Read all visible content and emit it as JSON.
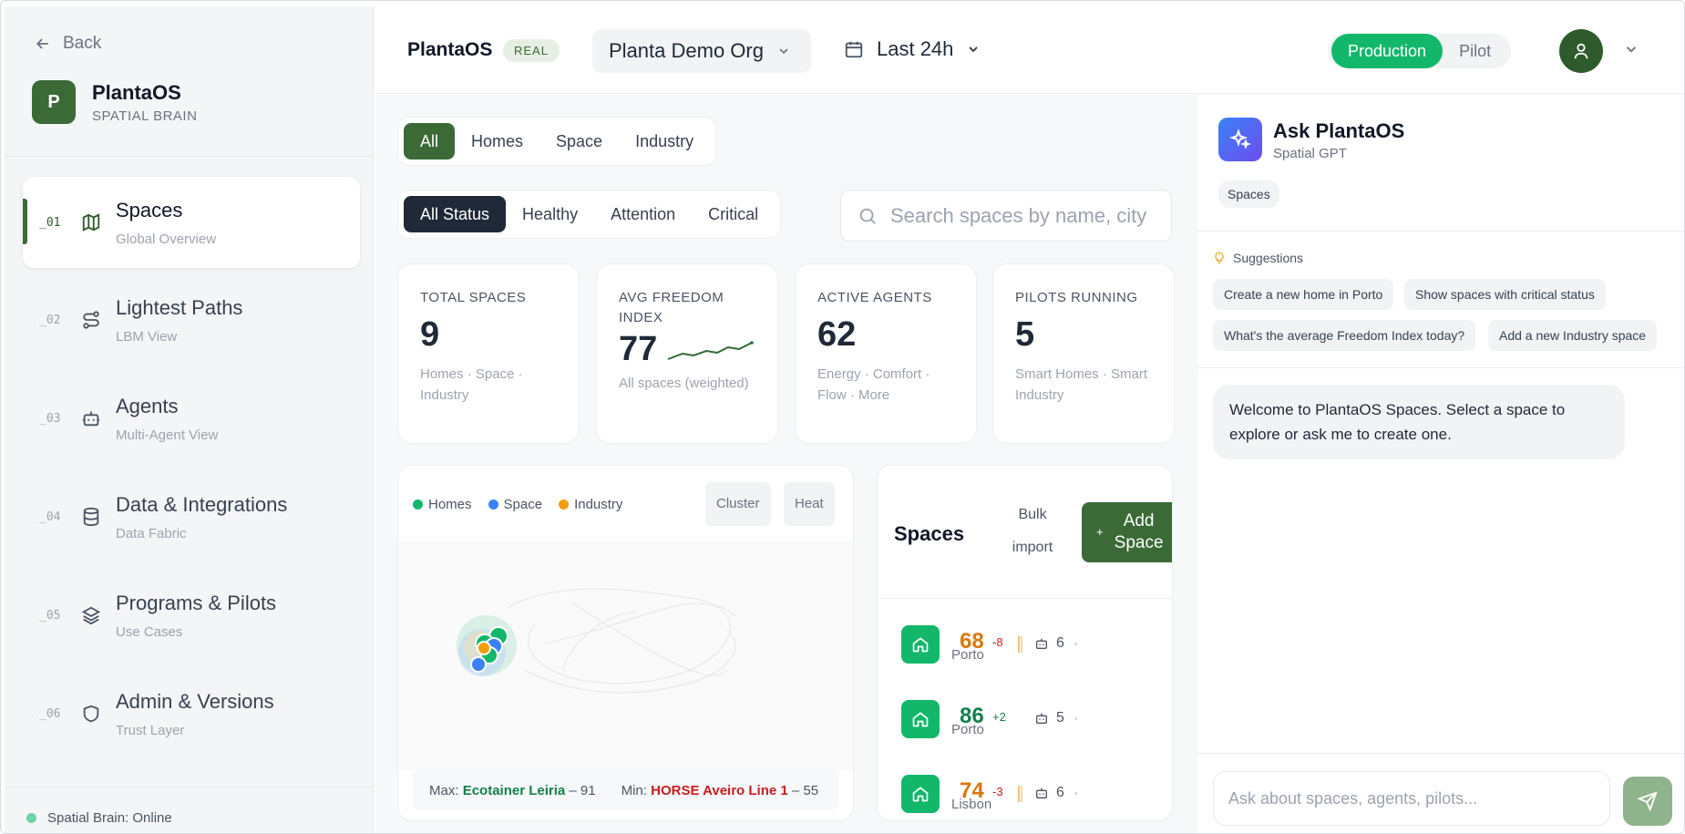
{
  "sidebar": {
    "back_label": "Back",
    "brand": {
      "logo_letter": "P",
      "name": "PlantaOS",
      "subtitle": "SPATIAL BRAIN"
    },
    "items": [
      {
        "num": "_01",
        "title": "Spaces",
        "sub": "Global Overview",
        "icon": "map-icon"
      },
      {
        "num": "_02",
        "title": "Lightest Paths",
        "sub": "LBM View",
        "icon": "route-icon"
      },
      {
        "num": "_03",
        "title": "Agents",
        "sub": "Multi-Agent View",
        "icon": "bot-icon"
      },
      {
        "num": "_04",
        "title": "Data & Integrations",
        "sub": "Data Fabric",
        "icon": "database-icon"
      },
      {
        "num": "_05",
        "title": "Programs & Pilots",
        "sub": "Use Cases",
        "icon": "layers-icon"
      },
      {
        "num": "_06",
        "title": "Admin & Versions",
        "sub": "Trust Layer",
        "icon": "shield-icon"
      }
    ],
    "status": "Spatial Brain: Online"
  },
  "topbar": {
    "app_name": "PlantaOS",
    "badge": "REAL",
    "org": "Planta Demo Org",
    "range": "Last 24h",
    "env": {
      "production": "Production",
      "pilot": "Pilot"
    }
  },
  "filters": {
    "types": [
      "All",
      "Homes",
      "Space",
      "Industry"
    ],
    "statuses": [
      "All Status",
      "Healthy",
      "Attention",
      "Critical"
    ],
    "search_placeholder": "Search spaces by name, city"
  },
  "kpis": [
    {
      "label": "TOTAL SPACES",
      "value": "9",
      "sub": "Homes · Space · Industry"
    },
    {
      "label": "AVG FREEDOM INDEX",
      "value": "77",
      "sub": "All spaces (weighted)"
    },
    {
      "label": "ACTIVE AGENTS",
      "value": "62",
      "sub": "Energy · Comfort · Flow · More"
    },
    {
      "label": "PILOTS RUNNING",
      "value": "5",
      "sub": "Smart Homes · Smart Industry"
    }
  ],
  "map": {
    "legend": [
      "Homes",
      "Space",
      "Industry"
    ],
    "buttons": {
      "cluster": "Cluster",
      "heat": "Heat"
    },
    "max_label": "Max:",
    "max_name": "Ecotainer Leiria",
    "max_value": "– 91",
    "min_label": "Min:",
    "min_name": "HORSE Aveiro Line 1",
    "min_value": "– 55"
  },
  "spaces": {
    "title": "Spaces",
    "bulk_import": "Bulk import",
    "add_label": "Add Space",
    "add_icon": "+",
    "rows": [
      {
        "score": "68",
        "delta": "-8",
        "city": "Porto",
        "agents": "6",
        "score_color": "#d97706",
        "delta_color": "#c81e1e"
      },
      {
        "score": "86",
        "delta": "+2",
        "city": "Porto",
        "agents": "5",
        "score_color": "#14804a",
        "delta_color": "#14804a"
      },
      {
        "score": "74",
        "delta": "-3",
        "city": "Lisbon",
        "agents": "6",
        "score_color": "#d97706",
        "delta_color": "#c81e1e"
      }
    ]
  },
  "assistant": {
    "title": "Ask PlantaOS",
    "subtitle": "Spatial GPT",
    "context_chip": "Spaces",
    "suggestions_label": "Suggestions",
    "suggestions": [
      "Create a new home in Porto",
      "Show spaces with critical status",
      "What's the average Freedom Index today?",
      "Add a new Industry space"
    ],
    "welcome": "Welcome to PlantaOS Spaces. Select a space to explore or ask me to create one.",
    "input_placeholder": "Ask about spaces, agents, pilots..."
  },
  "colors": {
    "brand_green": "#3b6a37",
    "production_green": "#12b76a",
    "homes": "#12b76a",
    "space": "#3b82f6",
    "industry": "#f59e0b"
  }
}
